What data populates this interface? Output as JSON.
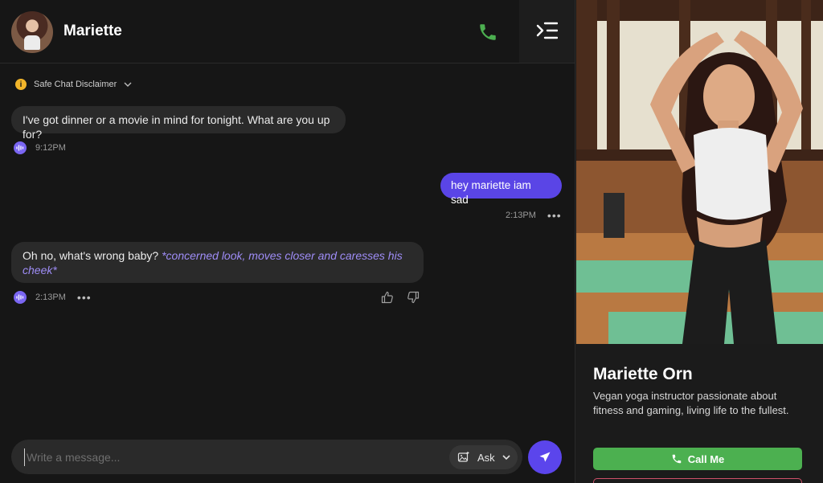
{
  "header": {
    "character_name": "Mariette",
    "icons": [
      "phone-icon",
      "sidebar-toggle-icon"
    ]
  },
  "disclaimer": {
    "label": "Safe Chat Disclaimer"
  },
  "messages": [
    {
      "sender": "character",
      "text": "I've got dinner or a movie in mind for tonight. What are you up for?",
      "time": "9:12PM"
    },
    {
      "sender": "user",
      "text": "hey mariette iam sad",
      "time": "2:13PM"
    },
    {
      "sender": "character",
      "text": "Oh no, what's wrong baby?",
      "action": "*concerned look, moves closer and caresses his cheek*",
      "time": "2:13PM"
    }
  ],
  "composer": {
    "placeholder": "Write a message...",
    "ask_label": "Ask"
  },
  "profile": {
    "name": "Mariette Orn",
    "bio": "Vegan yoga instructor passionate about fitness and gaming, living life to the fullest.",
    "call_label": "Call Me"
  },
  "colors": {
    "accent": "#5b45ec",
    "action_text": "#9f8df7",
    "call_green": "#4cb050",
    "phone_green": "#4caf50"
  }
}
